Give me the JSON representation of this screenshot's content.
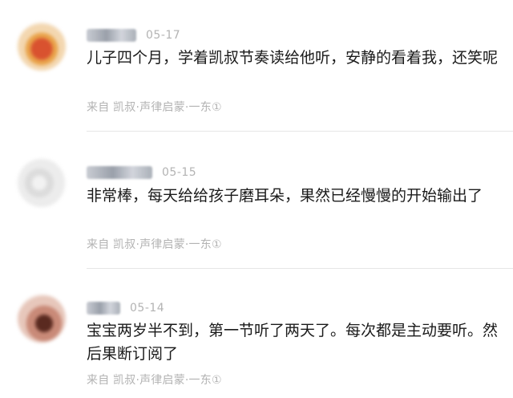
{
  "comments": [
    {
      "date": "05-17",
      "text": "儿子四个月，学着凯叔节奏读给他听，安静的看着我，还笑呢",
      "source": "来自 凯叔·声律启蒙·一东①",
      "avatar_icon": "user-avatar-blurred",
      "colors": {
        "text": "#1a1a1a",
        "meta": "#b3b3b3"
      }
    },
    {
      "date": "05-15",
      "text": "非常棒，每天给给孩子磨耳朵，果然已经慢慢的开始输出了",
      "source": "来自 凯叔·声律启蒙·一东①",
      "avatar_icon": "user-avatar-blurred"
    },
    {
      "date": "05-14",
      "text": "宝宝两岁半不到，第一节听了两天了。每次都是主动要听。然后果断订阅了",
      "source": "来自 凯叔·声律启蒙·一东①",
      "avatar_icon": "user-avatar-blurred"
    }
  ]
}
